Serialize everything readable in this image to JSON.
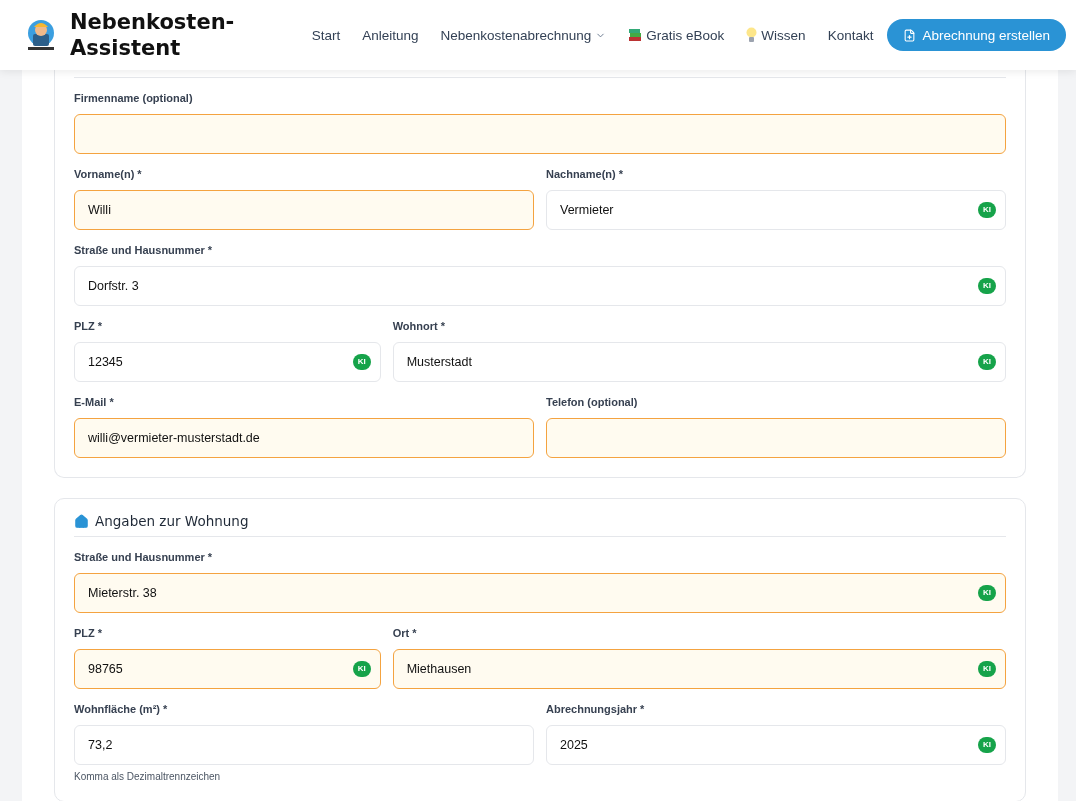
{
  "header": {
    "title": "Nebenkosten-Assistent",
    "nav": [
      {
        "label": "Start",
        "kind": "plain"
      },
      {
        "label": "Anleitung",
        "kind": "plain"
      },
      {
        "label": "Nebenkostenabrechnung",
        "kind": "dropdown"
      },
      {
        "label": "Gratis eBook",
        "kind": "books"
      },
      {
        "label": "Wissen",
        "kind": "bulb"
      },
      {
        "label": "Kontakt",
        "kind": "plain"
      }
    ],
    "cta": "Abrechnung erstellen"
  },
  "sections": [
    {
      "rows": [
        {
          "kind": "full",
          "fields": [
            {
              "label": "Firmenname (optional)",
              "highlighted": true
            }
          ]
        },
        {
          "kind": "half",
          "fields": [
            {
              "label": "Vorname(n) *",
              "value": "Willi",
              "highlighted": true
            },
            {
              "label": "Nachname(n) *",
              "value": "Vermieter",
              "highlighted": false,
              "badge": "KI"
            }
          ]
        },
        {
          "kind": "full",
          "fields": [
            {
              "label": "Straße und Hausnummer *",
              "value": "Dorfstr. 3",
              "highlighted": false,
              "badge": "KI"
            }
          ]
        },
        {
          "kind": "third",
          "fields": [
            {
              "label": "PLZ *",
              "value": "12345",
              "highlighted": false,
              "badge": "KI"
            },
            {
              "label": "Wohnort *",
              "value": "Musterstadt",
              "highlighted": false,
              "badge": "KI"
            }
          ]
        },
        {
          "kind": "half",
          "fields": [
            {
              "label": "E-Mail *",
              "value": "willi@vermieter-musterstadt.de",
              "highlighted": true
            },
            {
              "label": "Telefon (optional)",
              "highlighted": true
            }
          ]
        }
      ]
    },
    {
      "title": "Angaben zur Wohnung",
      "rows": [
        {
          "kind": "full",
          "fields": [
            {
              "label": "Straße und Hausnummer *",
              "value": "Mieterstr. 38",
              "highlighted": true,
              "badge": "KI"
            }
          ]
        },
        {
          "kind": "third",
          "fields": [
            {
              "label": "PLZ *",
              "value": "98765",
              "highlighted": true,
              "badge": "KI"
            },
            {
              "label": "Ort *",
              "value": "Miethausen",
              "highlighted": true,
              "badge": "KI"
            }
          ]
        },
        {
          "kind": "half",
          "fields": [
            {
              "label": "Wohnfläche (m²) *",
              "value": "73,2",
              "highlighted": false,
              "hint": "Komma als Dezimaltrennzeichen"
            },
            {
              "label": "Abrechnungsjahr *",
              "value": "2025",
              "highlighted": false,
              "badge": "KI"
            }
          ]
        }
      ]
    }
  ]
}
